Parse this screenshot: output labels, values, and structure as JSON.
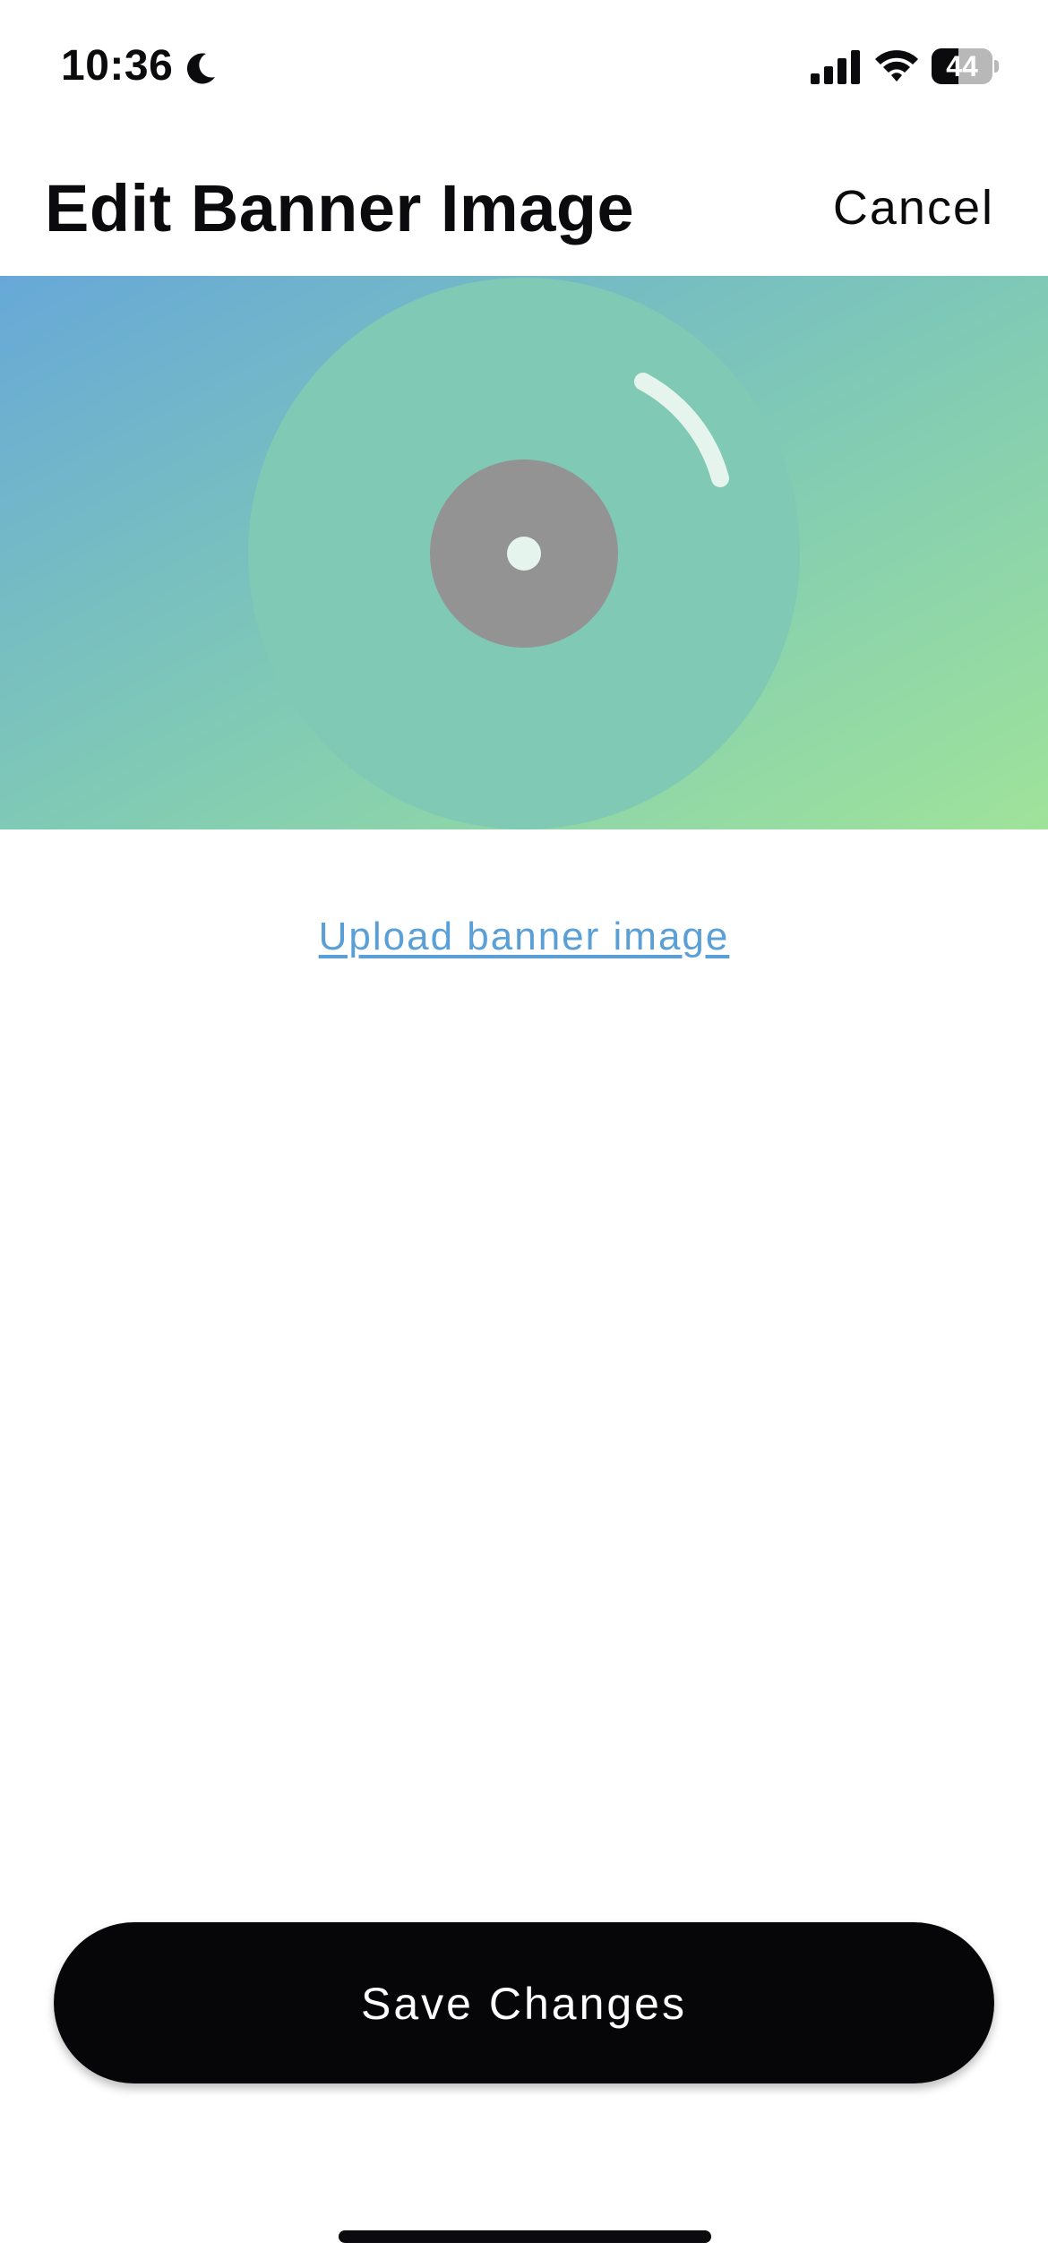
{
  "status_bar": {
    "time": "10:36",
    "battery_level": "44",
    "battery_fraction": 0.44,
    "icons": [
      "moon-icon",
      "signal-icon",
      "wifi-icon",
      "battery-icon"
    ]
  },
  "header": {
    "title": "Edit Banner Image",
    "cancel_label": "Cancel"
  },
  "banner": {
    "gradient_start": "#67a8d8",
    "gradient_mid": "#7fc9b6",
    "gradient_end": "#9fe39a",
    "disc_color": "#80c9b5",
    "label_color": "#939393",
    "spindle_color": "#e6f4ee",
    "sheen_color": "#e6f4ee",
    "icon": "vinyl-record-icon"
  },
  "upload": {
    "label": "Upload banner image",
    "color": "#5aa0d6"
  },
  "save": {
    "label": "Save Changes"
  }
}
